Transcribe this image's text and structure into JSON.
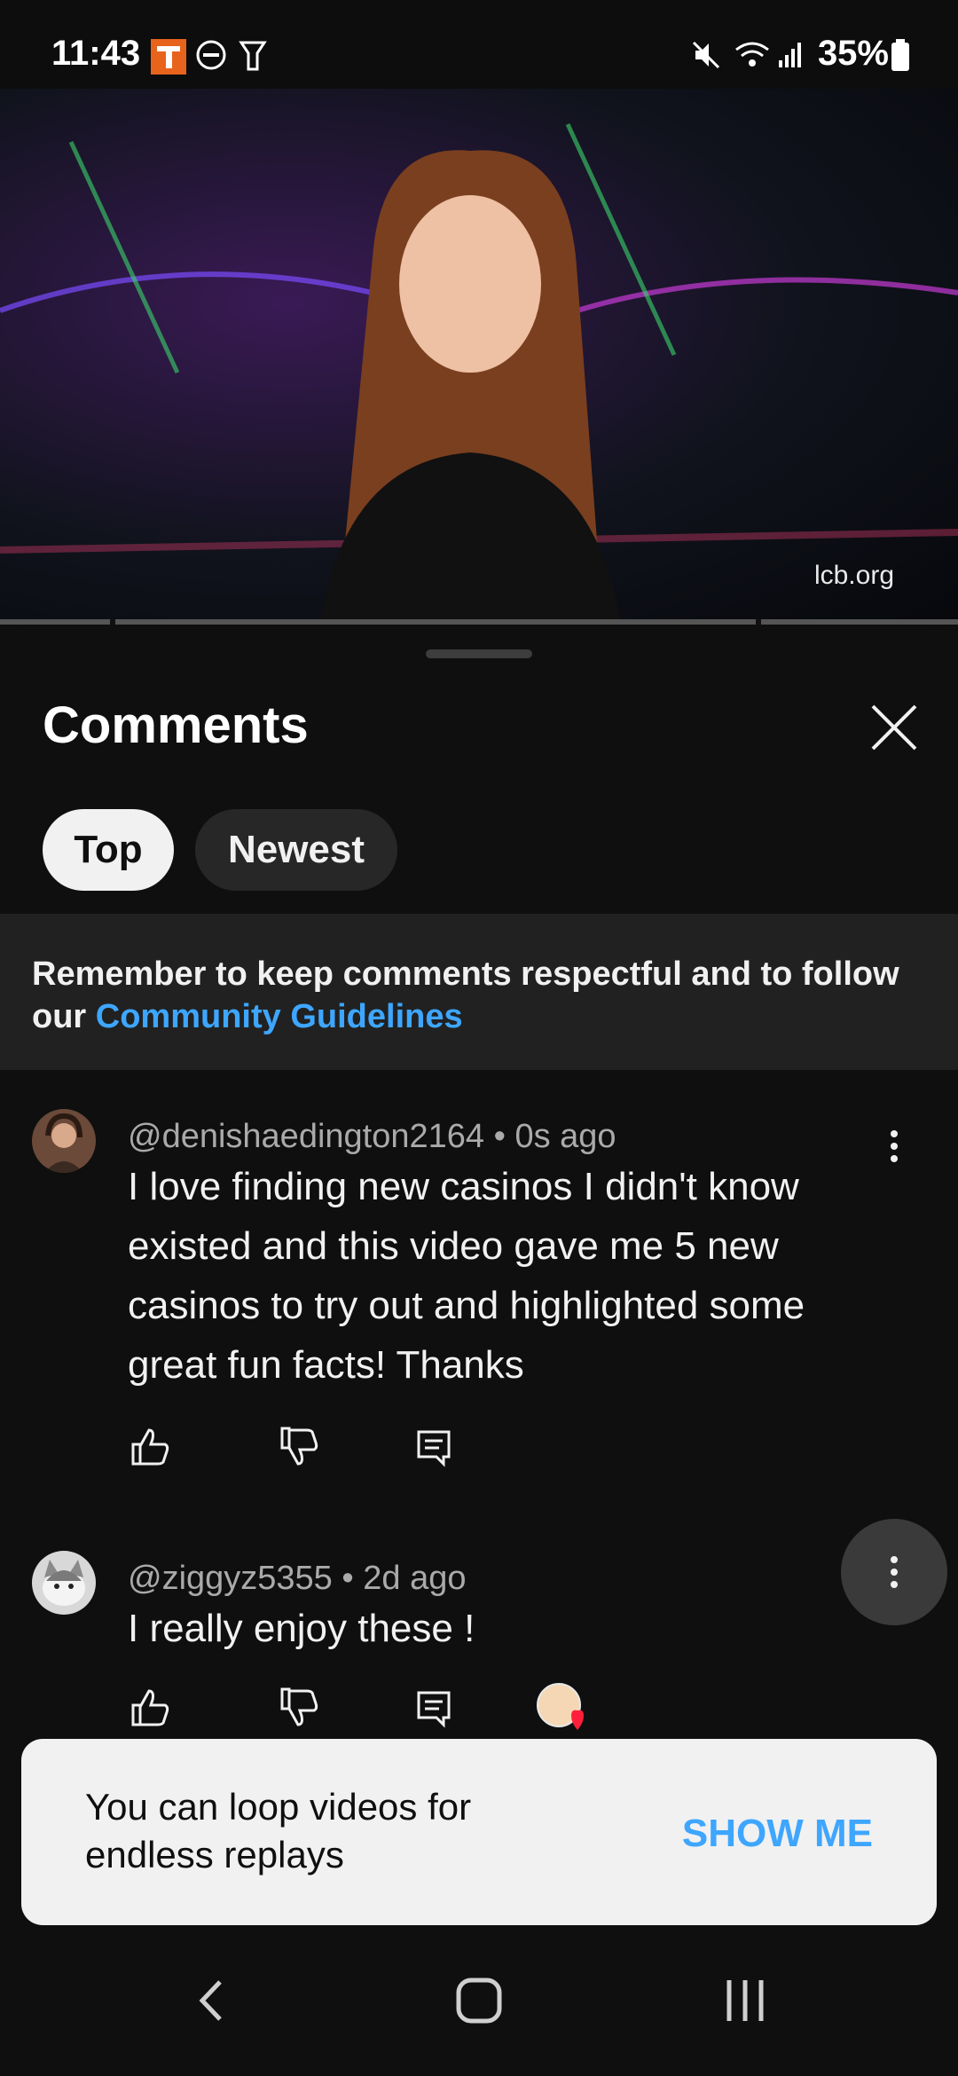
{
  "status_bar": {
    "time": "11:43",
    "battery": "35%",
    "icons": [
      "t-app-icon",
      "dnd-icon",
      "flashlight-icon",
      "mute-icon",
      "wifi-icon",
      "signal-icon",
      "battery-icon"
    ]
  },
  "video": {
    "watermark": "lcb.org"
  },
  "comments_sheet": {
    "title": "Comments",
    "filters": [
      {
        "label": "Top",
        "selected": true
      },
      {
        "label": "Newest",
        "selected": false
      }
    ],
    "notice": {
      "text": "Remember to keep comments respectful and to follow our ",
      "link": "Community Guidelines"
    },
    "comments": [
      {
        "author": "@denishaedington2164",
        "separator": " • ",
        "time": "0s ago",
        "text": "I love finding new casinos I didn't know existed and this video gave me 5 new casinos to try out and highlighted some great fun facts! Thanks"
      },
      {
        "author": "@ziggyz5355",
        "separator": " • ",
        "time": "2d ago",
        "text": "I really enjoy these !"
      }
    ]
  },
  "toast": {
    "message": "You can loop videos for endless replays",
    "action": "SHOW ME"
  },
  "colors": {
    "background": "#0f0f0f",
    "link": "#3ea6ff",
    "chip_selected": "#f1f1f1",
    "chip": "#272727"
  }
}
